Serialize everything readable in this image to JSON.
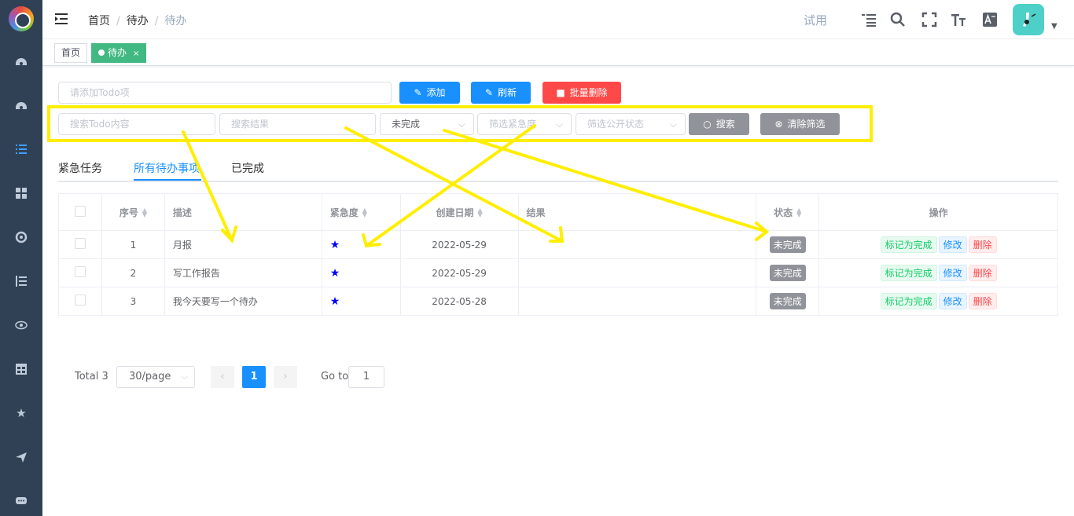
{
  "breadcrumb": {
    "home": "首页",
    "sep": "/",
    "level2": "待办",
    "level3": "待办"
  },
  "navbar": {
    "trial": "试用",
    "icons": [
      "outline-list-icon",
      "search-icon",
      "fullscreen-icon",
      "font-size-icon",
      "translate-icon"
    ]
  },
  "tags": {
    "home": "首页",
    "active": "待办",
    "close": "×"
  },
  "toolbar": {
    "add_placeholder": "请添加Todo项",
    "add_label": "添加",
    "refresh_label": "刷新",
    "batch_delete_label": "批量删除"
  },
  "filters": {
    "content_placeholder": "搜索Todo内容",
    "result_placeholder": "搜索结果",
    "status_value": "未完成",
    "urgency_placeholder": "筛选紧急度",
    "public_placeholder": "筛选公开状态",
    "search_label": "搜索",
    "clear_label": "清除筛选"
  },
  "tabs": {
    "urgent": "紧急任务",
    "all": "所有待办事项",
    "done": "已完成"
  },
  "table": {
    "headers": {
      "index": "序号",
      "desc": "描述",
      "urgency": "紧急度",
      "created": "创建日期",
      "result": "结果",
      "status": "状态",
      "ops": "操作"
    },
    "rows": [
      {
        "index": "1",
        "desc": "月报",
        "created": "2022-05-29",
        "result": "",
        "status": "未完成"
      },
      {
        "index": "2",
        "desc": "写工作报告",
        "created": "2022-05-29",
        "result": "",
        "status": "未完成"
      },
      {
        "index": "3",
        "desc": "我今天要写一个待办",
        "created": "2022-05-28",
        "result": "",
        "status": "未完成"
      }
    ],
    "ops": {
      "complete": "标记为完成",
      "edit": "修改",
      "delete": "删除"
    }
  },
  "pagination": {
    "total": "Total 3",
    "page_size": "30/page",
    "prev": "‹",
    "current": "1",
    "next": "›",
    "goto": "Go to",
    "goto_value": "1"
  },
  "colors": {
    "sidebar": "#304156",
    "primary": "#1890ff",
    "danger": "#ff4949",
    "tag_active": "#42b983",
    "annotation": "#ffee00"
  }
}
